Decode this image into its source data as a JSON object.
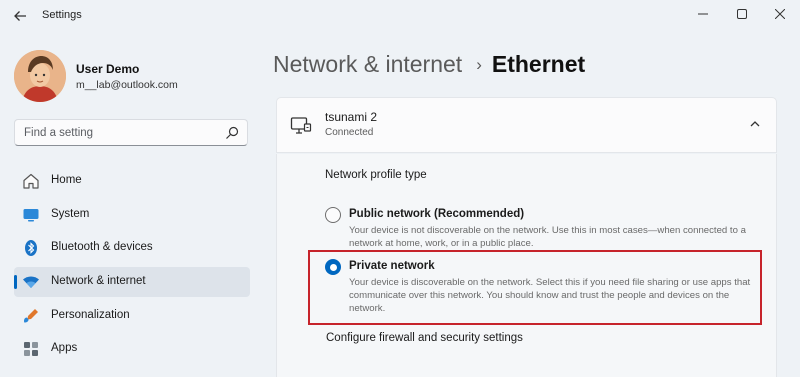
{
  "window": {
    "title": "Settings",
    "back_icon": "arrow-left-icon",
    "minimize_icon": "minimize-icon",
    "maximize_icon": "maximize-icon",
    "close_icon": "close-icon"
  },
  "user": {
    "name": "User Demo",
    "email": "m__lab@outlook.com"
  },
  "search": {
    "placeholder": "Find a setting",
    "icon": "search-icon"
  },
  "sidebar": {
    "items": [
      {
        "label": "Home",
        "icon": "home-icon",
        "active": false
      },
      {
        "label": "System",
        "icon": "system-icon",
        "active": false
      },
      {
        "label": "Bluetooth & devices",
        "icon": "bluetooth-icon",
        "active": false
      },
      {
        "label": "Network & internet",
        "icon": "wifi-icon",
        "active": true
      },
      {
        "label": "Personalization",
        "icon": "personalization-icon",
        "active": false
      },
      {
        "label": "Apps",
        "icon": "apps-icon",
        "active": false
      }
    ]
  },
  "header": {
    "parent": "Network & internet",
    "separator": "›",
    "current": "Ethernet"
  },
  "connection": {
    "name": "tsunami 2",
    "status": "Connected",
    "expanded": true
  },
  "profile": {
    "label": "Network profile type",
    "options": [
      {
        "title": "Public network (Recommended)",
        "description": "Your device is not discoverable on the network. Use this in most cases—when connected to a network at home, work, or in a public place.",
        "selected": false
      },
      {
        "title": "Private network",
        "description": "Your device is discoverable on the network. Select this if you need file sharing or use apps that communicate over this network. You should know and trust the people and devices on the network.",
        "selected": true
      }
    ]
  },
  "firewall_link": "Configure firewall and security settings",
  "colors": {
    "accent": "#0067c0",
    "highlight_border": "#c6232b",
    "background": "#eef2f6"
  }
}
